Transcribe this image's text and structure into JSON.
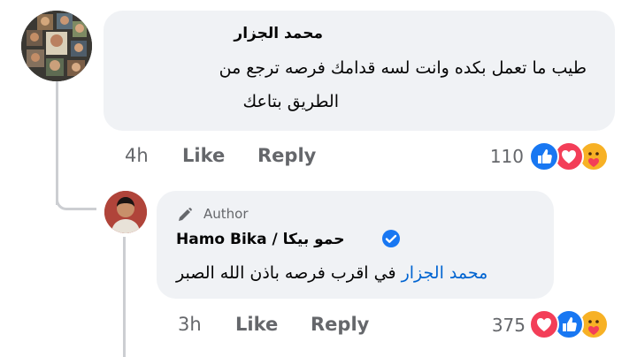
{
  "comment1": {
    "author": "محمد الجزار",
    "text_line1": "طيب ما تعمل بكده وانت لسه قدامك فرصه ترجع من",
    "text_line2": "الطريق بتاعك",
    "time": "4h",
    "like_label": "Like",
    "reply_label": "Reply",
    "reaction_count": "110",
    "reactions": [
      "like-icon",
      "love-icon",
      "care-icon"
    ]
  },
  "reply1": {
    "badge_label": "Author",
    "author": "Hamo Bika / حمو بيكا",
    "mention": "محمد الجزار",
    "text": "في اقرب فرصه باذن الله الصبر",
    "time": "3h",
    "like_label": "Like",
    "reply_label": "Reply",
    "reaction_count": "375",
    "reactions": [
      "love-icon",
      "like-icon",
      "care-icon"
    ]
  },
  "colors": {
    "bubble": "#f0f2f5",
    "meta_text": "#65676b",
    "mention": "#0064d1",
    "like_blue": "#1877f2",
    "love_red": "#f33e58",
    "care_yellow": "#f7b125"
  }
}
